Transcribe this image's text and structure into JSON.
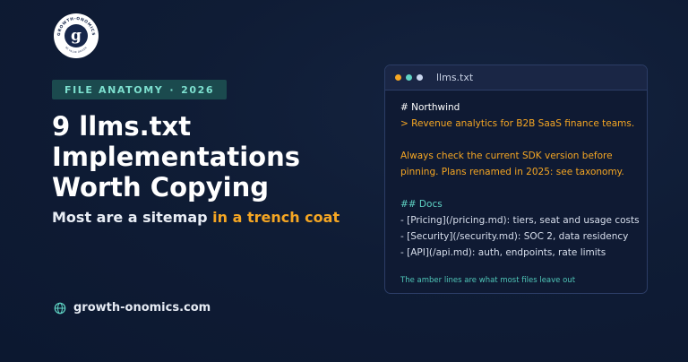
{
  "logo": {
    "ring_text": "GROWTH-ONOMICS",
    "ring_subtext": "BE VALUE DRIVEN",
    "monogram": "g"
  },
  "tag": {
    "left": "FILE ANATOMY",
    "sep": "·",
    "right": "2026"
  },
  "title": {
    "lines": [
      "9 llms.txt",
      "Implementations",
      "Worth Copying"
    ]
  },
  "subtitle": {
    "plain": "Most are a sitemap ",
    "highlight": "in a trench coat"
  },
  "site": {
    "icon": "globe-icon",
    "url": "growth-onomics.com"
  },
  "window": {
    "dots": [
      "#f5a623",
      "#5fd3c4",
      "#c9d6ee"
    ],
    "filename": "llms.txt",
    "h1": "# Northwind",
    "summary": "> Revenue analytics for B2B SaaS finance teams.",
    "note_line1": "Always check the current SDK version before",
    "note_line2": "pinning. Plans renamed in 2025: see taxonomy.",
    "h2": "## Docs",
    "links": [
      "- [Pricing](/pricing.md): tiers, seat and usage costs",
      "- [Security](/security.md): SOC 2, data residency",
      "- [API](/api.md): auth, endpoints, rate limits"
    ],
    "footnote": "The amber lines are what most files leave out"
  },
  "colors": {
    "background": "#0f1c35",
    "accent_amber": "#f5a623",
    "accent_teal": "#5fd3c4"
  }
}
